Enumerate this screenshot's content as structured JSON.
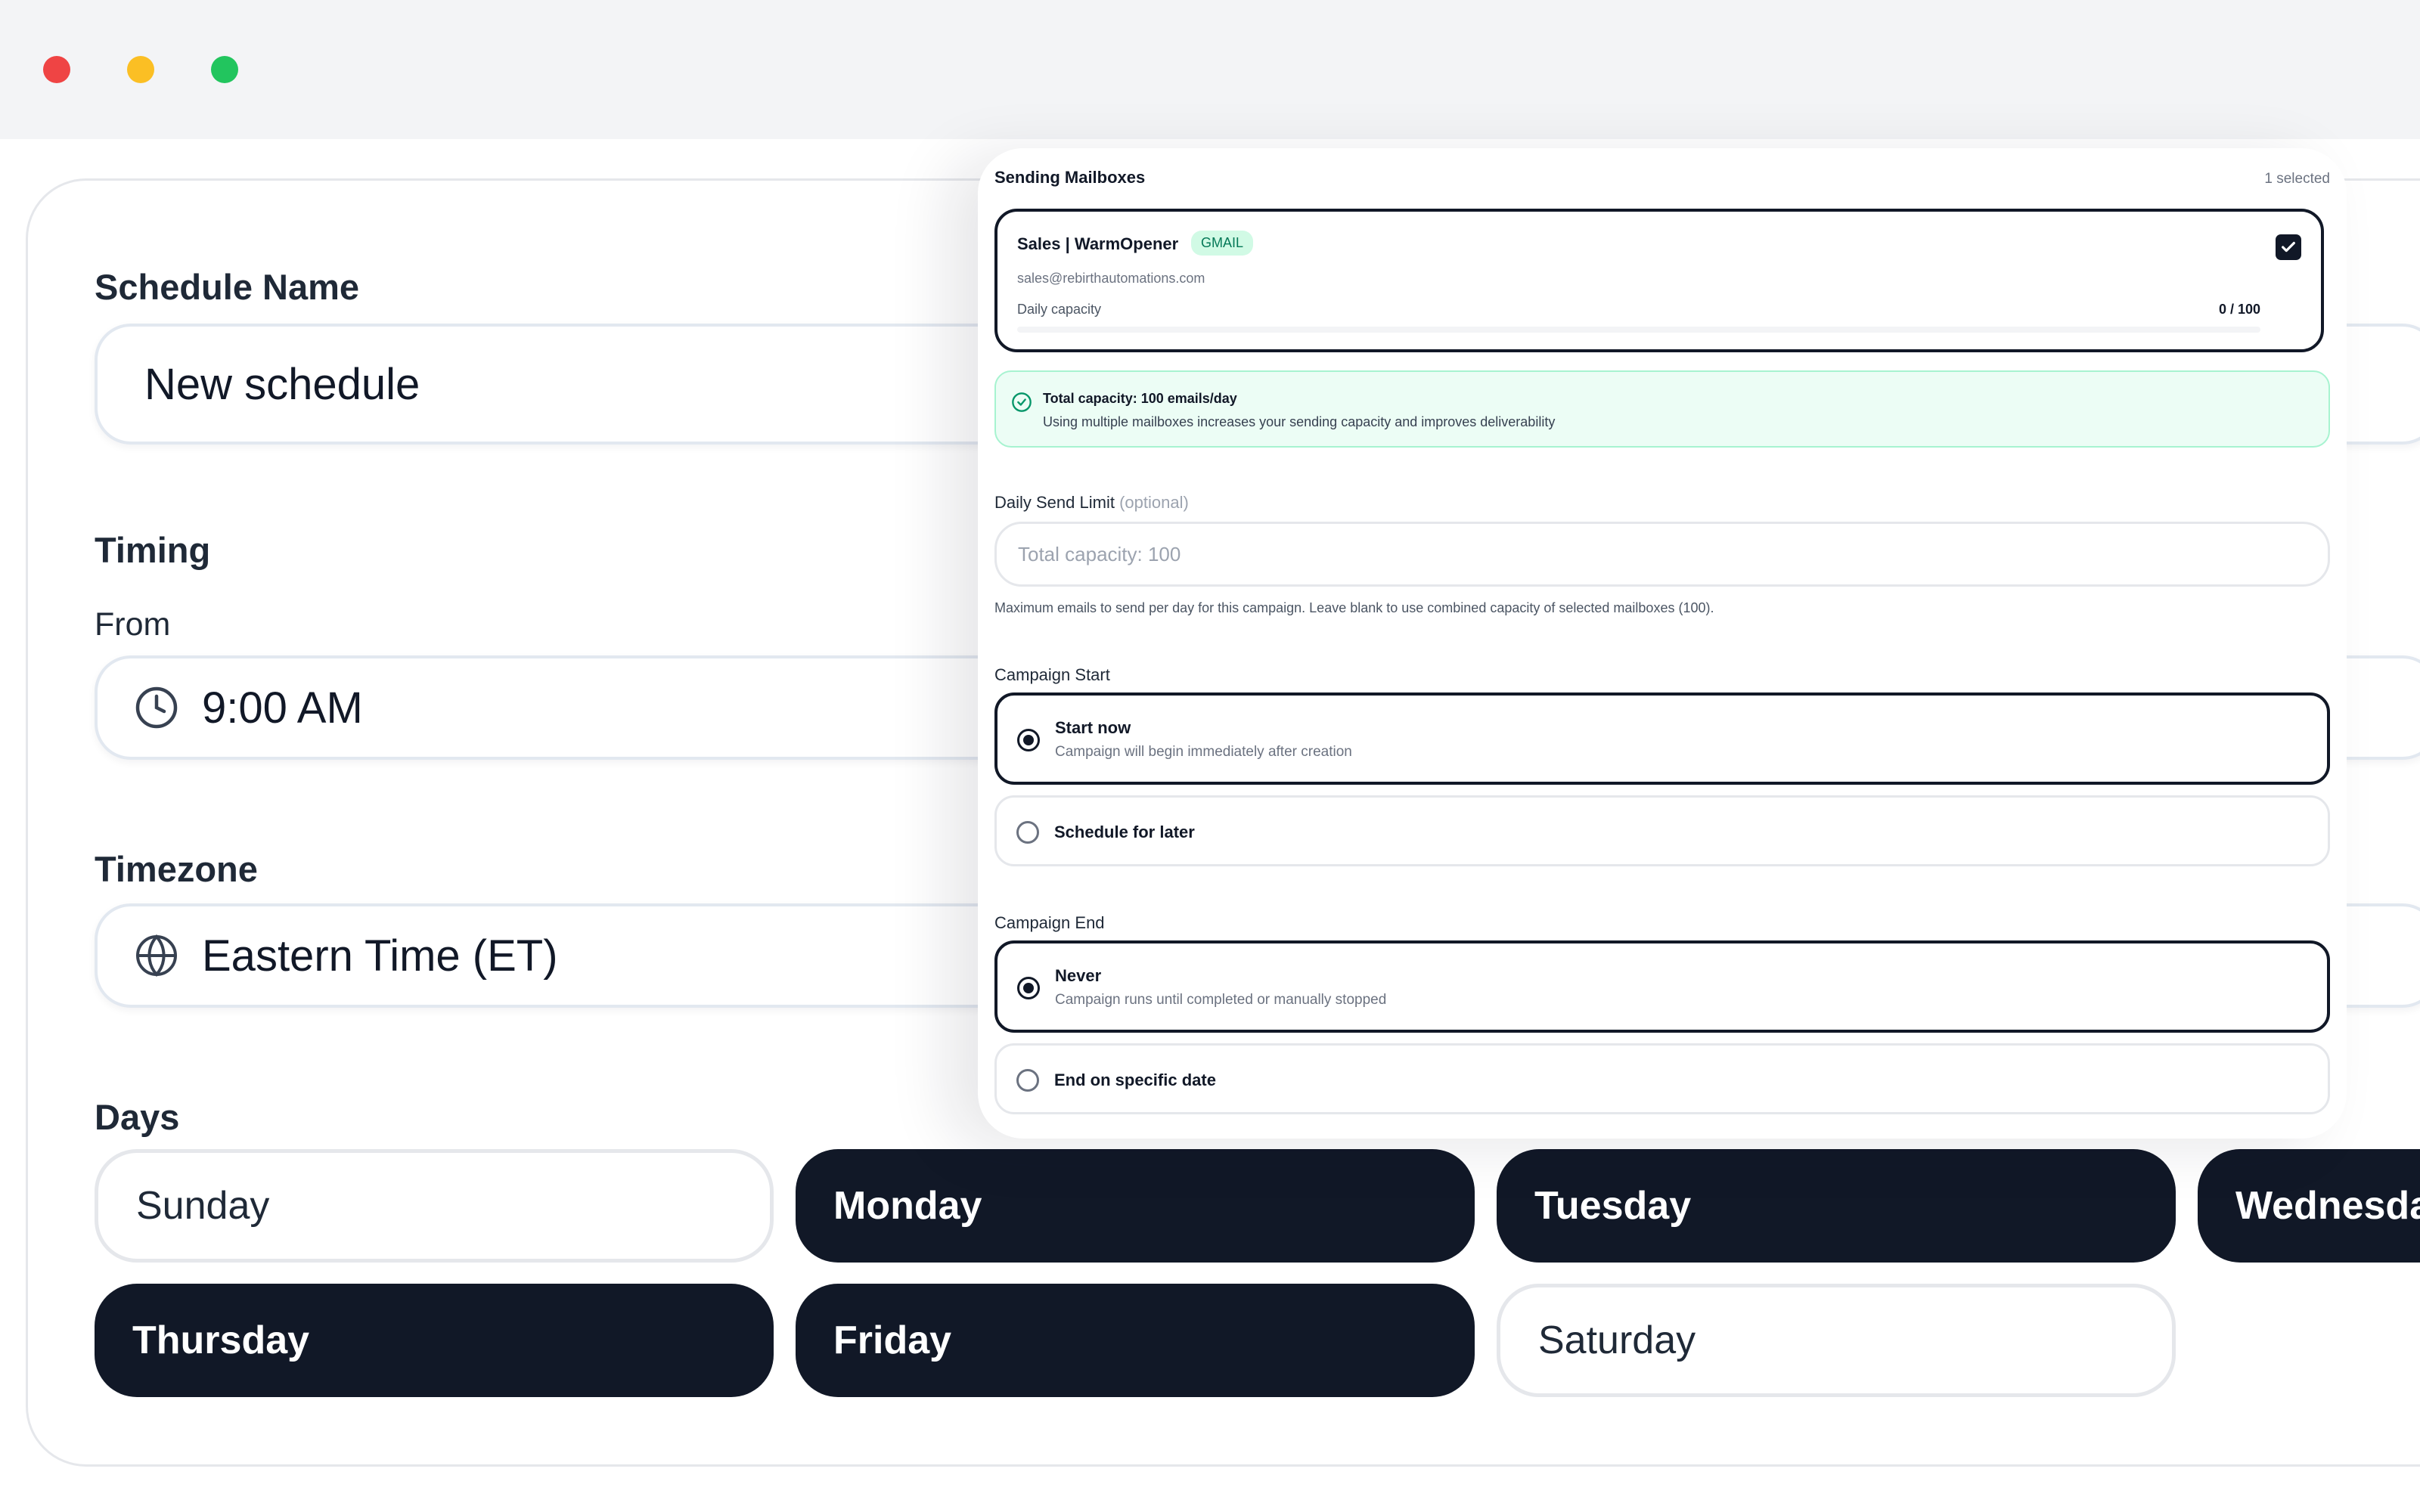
{
  "schedule": {
    "name_label": "Schedule Name",
    "name_value": "New schedule",
    "timing_label": "Timing",
    "from_label": "From",
    "from_value": "9:00 AM",
    "timezone_label": "Timezone",
    "timezone_value": "Eastern Time (ET)",
    "days_label": "Days",
    "days": [
      {
        "label": "Sunday",
        "selected": false
      },
      {
        "label": "Monday",
        "selected": true
      },
      {
        "label": "Tuesday",
        "selected": true
      },
      {
        "label": "Wednesda",
        "selected": true
      },
      {
        "label": "Thursday",
        "selected": true
      },
      {
        "label": "Friday",
        "selected": true
      },
      {
        "label": "Saturday",
        "selected": false
      }
    ]
  },
  "panel": {
    "mailboxes_title": "Sending Mailboxes",
    "selected_count": "1 selected",
    "mailbox": {
      "name": "Sales | WarmOpener",
      "badge": "GMAIL",
      "email": "sales@rebirthautomations.com",
      "capacity_label": "Daily capacity",
      "capacity_value": "0 / 100",
      "capacity_fraction": 0,
      "checked": true
    },
    "info": {
      "title": "Total capacity: 100 emails/day",
      "description": "Using multiple mailboxes increases your sending capacity and improves deliverability"
    },
    "daily_limit": {
      "label": "Daily Send Limit",
      "optional": "(optional)",
      "placeholder": "Total capacity: 100",
      "help": "Maximum emails to send per day for this campaign. Leave blank to use combined capacity of selected mailboxes (100)."
    },
    "campaign_start": {
      "label": "Campaign Start",
      "options": [
        {
          "title": "Start now",
          "description": "Campaign will begin immediately after creation",
          "selected": true
        },
        {
          "title": "Schedule for later",
          "description": "",
          "selected": false
        }
      ]
    },
    "campaign_end": {
      "label": "Campaign End",
      "options": [
        {
          "title": "Never",
          "description": "Campaign runs until completed or manually stopped",
          "selected": true
        },
        {
          "title": "End on specific date",
          "description": "",
          "selected": false
        }
      ]
    }
  },
  "colors": {
    "primary": "#111827",
    "success_bg": "#ecfdf5",
    "success_border": "#a7f3d0",
    "badge_bg": "#d1fae5",
    "badge_text": "#047857"
  },
  "icons": {
    "from": "clock-icon",
    "timezone": "globe-icon",
    "info": "check-circle-icon",
    "mailbox_checkbox": "check-icon"
  }
}
